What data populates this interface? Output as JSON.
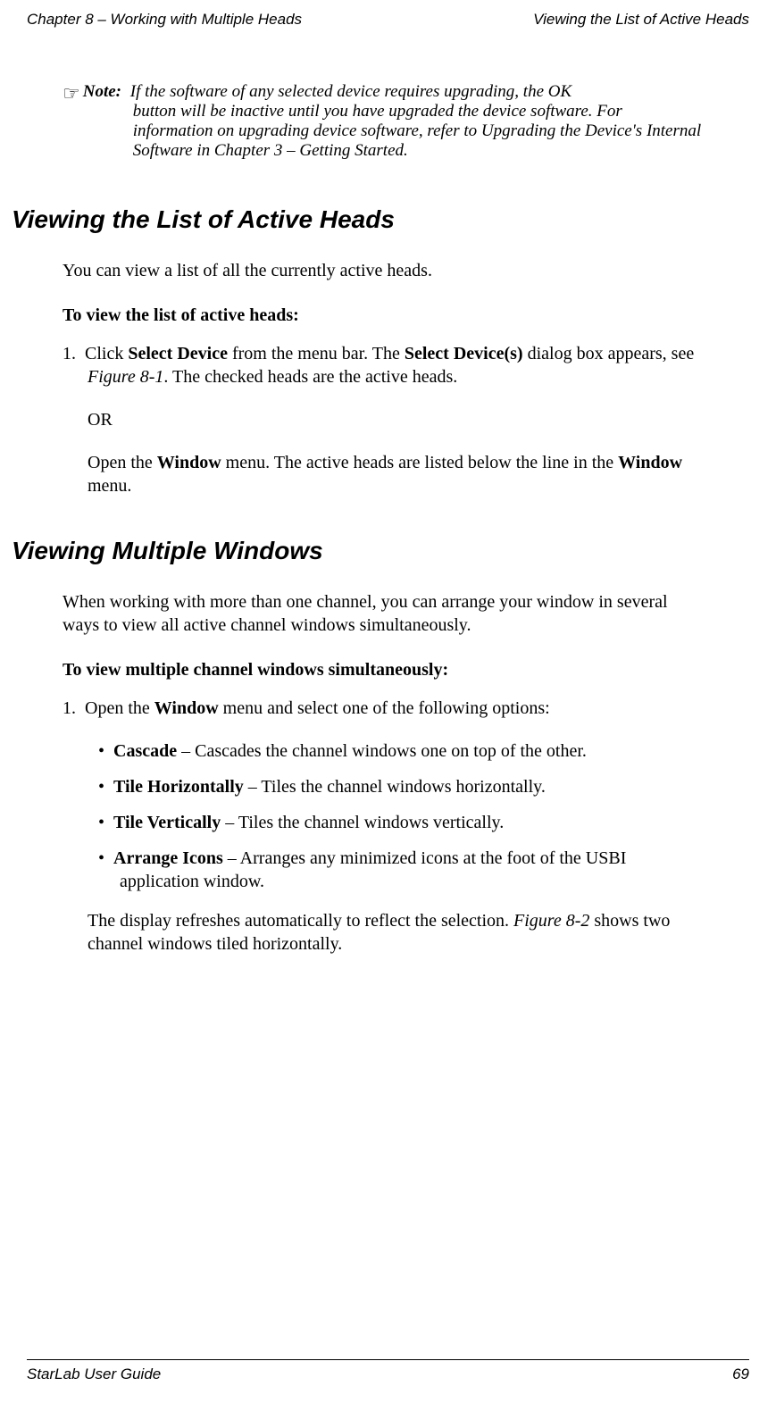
{
  "header": {
    "left": "Chapter 8 – Working with Multiple Heads",
    "right": "Viewing the List of Active Heads"
  },
  "note": {
    "label": "Note:",
    "text_line1": "If the software of any selected device requires upgrading, the OK",
    "text_rest": "button will be inactive until you have upgraded the device software. For information on upgrading device software, refer to Upgrading the Device's Internal Software in Chapter 3 – Getting Started."
  },
  "section1": {
    "heading": "Viewing the List of Active Heads",
    "intro": "You can view a list of all the currently active heads.",
    "lead": "To view the list of active heads:",
    "step1_num": "1.",
    "step1_a": "Click ",
    "step1_b": "Select Device",
    "step1_c": " from the menu bar. The ",
    "step1_d": "Select Device(s)",
    "step1_e": " dialog box appears, see ",
    "step1_f": "Figure 8-1",
    "step1_g": ". The checked heads are the active heads.",
    "or": "OR",
    "step1_alt_a": "Open the ",
    "step1_alt_b": "Window",
    "step1_alt_c": " menu. The active heads are listed below the line in the ",
    "step1_alt_d": "Window",
    "step1_alt_e": " menu."
  },
  "section2": {
    "heading": "Viewing Multiple Windows",
    "intro": "When working with more than one channel, you can arrange your window in several ways to view all active channel windows simultaneously.",
    "lead": "To view multiple channel windows simultaneously:",
    "step1_num": "1.",
    "step1_a": "Open the ",
    "step1_b": "Window",
    "step1_c": " menu and select one of the following options:",
    "bullets": [
      {
        "name": "Cascade",
        "desc": " – Cascades the channel windows one on top of the other."
      },
      {
        "name": "Tile Horizontally",
        "desc": " – Tiles the channel windows horizontally."
      },
      {
        "name": "Tile Vertically",
        "desc": " – Tiles the channel windows vertically."
      },
      {
        "name": "Arrange Icons",
        "desc": " – Arranges any minimized icons at the foot of the USBI application window."
      }
    ],
    "closing_a": "The display refreshes automatically to reflect the selection. ",
    "closing_b": "Figure 8-2",
    "closing_c": " shows two channel windows tiled horizontally."
  },
  "footer": {
    "left": "StarLab User Guide",
    "right": "69"
  }
}
